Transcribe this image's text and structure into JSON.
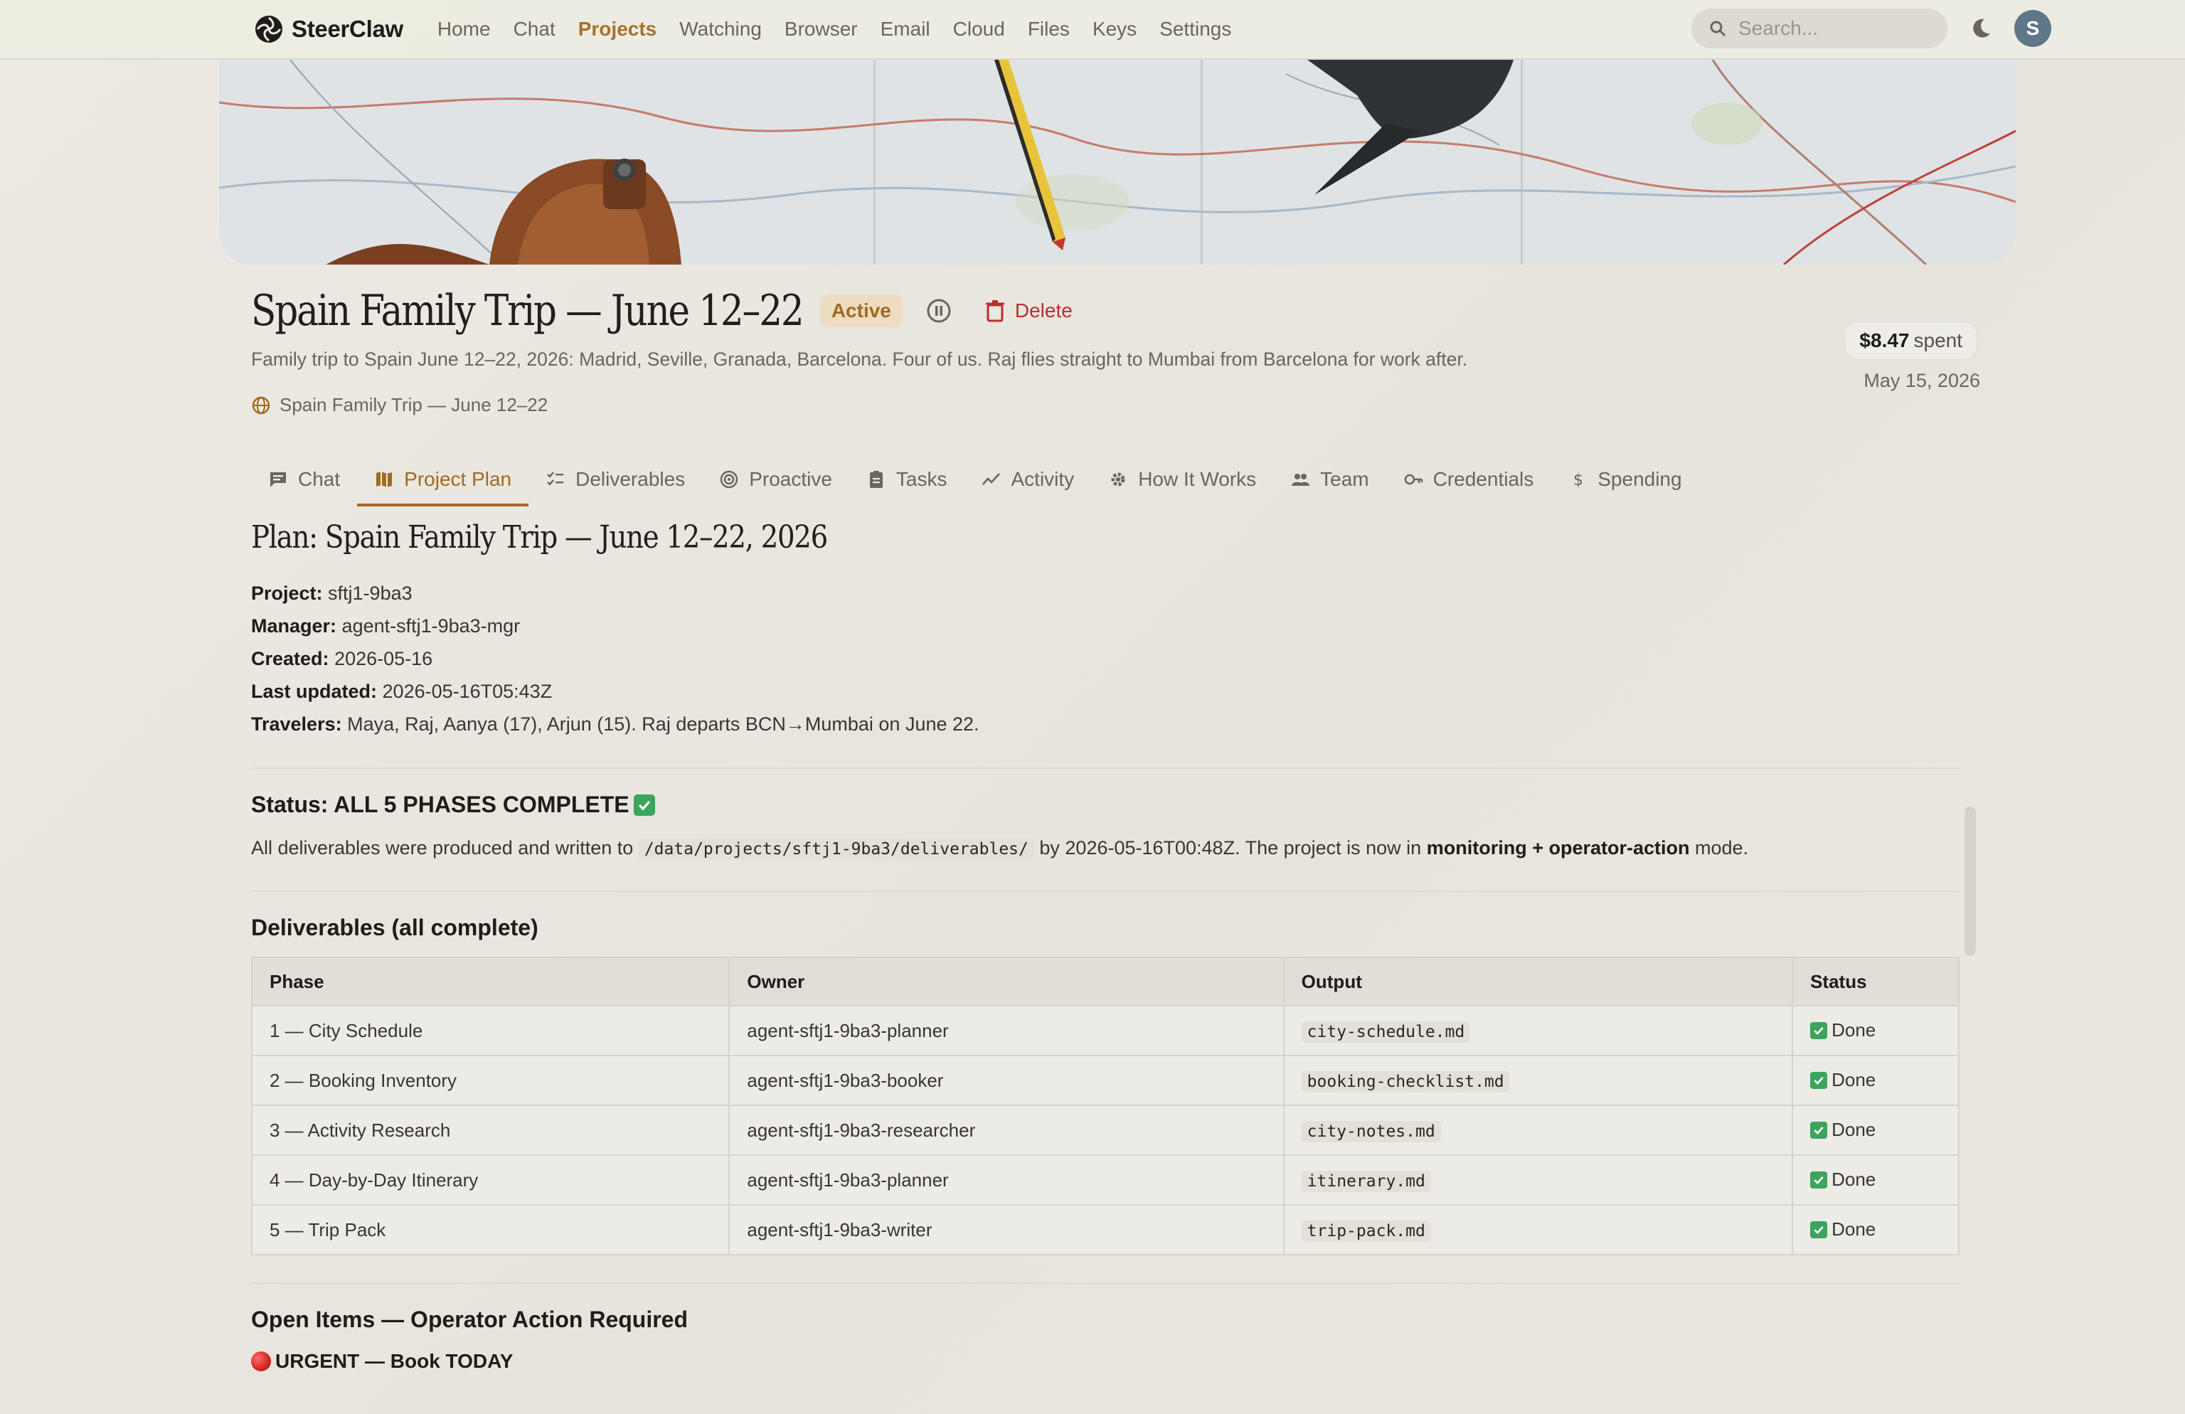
{
  "brand": {
    "name": "SteerClaw"
  },
  "nav": {
    "links": [
      "Home",
      "Chat",
      "Projects",
      "Watching",
      "Browser",
      "Email",
      "Cloud",
      "Files",
      "Keys",
      "Settings"
    ],
    "active": "Projects"
  },
  "search": {
    "placeholder": "Search..."
  },
  "user": {
    "initial": "S"
  },
  "project": {
    "title": "Spain Family Trip — June 12–22",
    "status": "Active",
    "delete_label": "Delete",
    "description": "Family trip to Spain June 12–22, 2026: Madrid, Seville, Granada, Barcelona. Four of us. Raj flies straight to Mumbai from Barcelona for work after.",
    "link_label": "Spain Family Trip — June 12–22",
    "spent_amount": "$8.47",
    "spent_label": "spent",
    "date": "May 15, 2026"
  },
  "tabs": [
    "Chat",
    "Project Plan",
    "Deliverables",
    "Proactive",
    "Tasks",
    "Activity",
    "How It Works",
    "Team",
    "Credentials",
    "Spending"
  ],
  "active_tab": "Project Plan",
  "plan": {
    "title": "Plan: Spain Family Trip — June 12–22, 2026",
    "meta": [
      {
        "key": "Project:",
        "value": "sftj1-9ba3"
      },
      {
        "key": "Manager:",
        "value": "agent-sftj1-9ba3-mgr"
      },
      {
        "key": "Created:",
        "value": "2026-05-16"
      },
      {
        "key": "Last updated:",
        "value": "2026-05-16T05:43Z"
      },
      {
        "key": "Travelers:",
        "value": "Maya, Raj, Aanya (17), Arjun (15). Raj departs BCN→Mumbai on June 22."
      }
    ],
    "status_heading": "Status: ALL 5 PHASES COMPLETE",
    "status_text_1": "All deliverables were produced and written to",
    "status_path": "/data/projects/sftj1-9ba3/deliverables/",
    "status_text_2": "by 2026-05-16T00:48Z. The project is now in",
    "status_mode": "monitoring + operator-action",
    "status_text_3": "mode.",
    "deliverables_heading": "Deliverables (all complete)",
    "table_headers": [
      "Phase",
      "Owner",
      "Output",
      "Status"
    ],
    "rows": [
      {
        "phase": "1 — City Schedule",
        "owner": "agent-sftj1-9ba3-planner",
        "output": "city-schedule.md",
        "status": "Done"
      },
      {
        "phase": "2 — Booking Inventory",
        "owner": "agent-sftj1-9ba3-booker",
        "output": "booking-checklist.md",
        "status": "Done"
      },
      {
        "phase": "3 — Activity Research",
        "owner": "agent-sftj1-9ba3-researcher",
        "output": "city-notes.md",
        "status": "Done"
      },
      {
        "phase": "4 — Day-by-Day Itinerary",
        "owner": "agent-sftj1-9ba3-planner",
        "output": "itinerary.md",
        "status": "Done"
      },
      {
        "phase": "5 — Trip Pack",
        "owner": "agent-sftj1-9ba3-writer",
        "output": "trip-pack.md",
        "status": "Done"
      }
    ],
    "open_items_heading": "Open Items — Operator Action Required",
    "urgent_label": "URGENT — Book TODAY"
  },
  "colors": {
    "accent": "#a3691f",
    "danger": "#b8302c",
    "success": "#3ba55d",
    "avatar": "#5f7787"
  }
}
